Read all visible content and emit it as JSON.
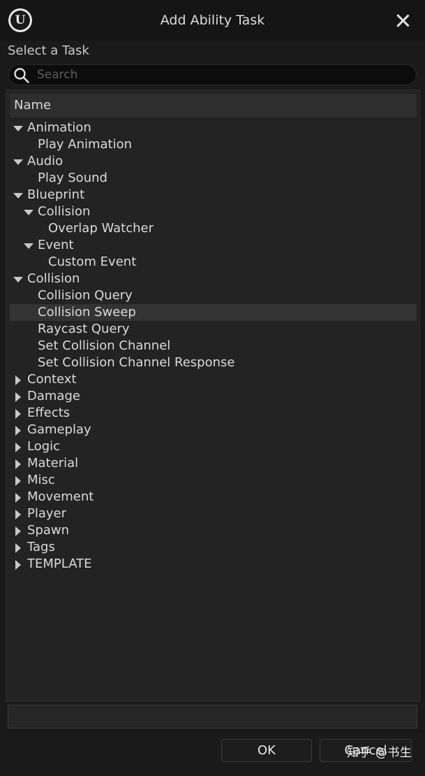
{
  "window": {
    "title": "Add Ability Task",
    "logo_icon": "unreal-engine-logo",
    "logo_glyph": "U"
  },
  "section_label": "Select a Task",
  "search": {
    "placeholder": "Search",
    "value": ""
  },
  "tree": {
    "column_header": "Name",
    "items": [
      {
        "label": "Animation",
        "depth": 0,
        "state": "expanded"
      },
      {
        "label": "Play Animation",
        "depth": 1,
        "state": "leaf"
      },
      {
        "label": "Audio",
        "depth": 0,
        "state": "expanded"
      },
      {
        "label": "Play Sound",
        "depth": 1,
        "state": "leaf"
      },
      {
        "label": "Blueprint",
        "depth": 0,
        "state": "expanded"
      },
      {
        "label": "Collision",
        "depth": 1,
        "state": "expanded"
      },
      {
        "label": "Overlap Watcher",
        "depth": 2,
        "state": "leaf"
      },
      {
        "label": "Event",
        "depth": 1,
        "state": "expanded"
      },
      {
        "label": "Custom Event",
        "depth": 2,
        "state": "leaf"
      },
      {
        "label": "Collision",
        "depth": 0,
        "state": "expanded"
      },
      {
        "label": "Collision Query",
        "depth": 1,
        "state": "leaf"
      },
      {
        "label": "Collision Sweep",
        "depth": 1,
        "state": "leaf",
        "selected": true
      },
      {
        "label": "Raycast Query",
        "depth": 1,
        "state": "leaf"
      },
      {
        "label": "Set Collision Channel",
        "depth": 1,
        "state": "leaf"
      },
      {
        "label": "Set Collision Channel Response",
        "depth": 1,
        "state": "leaf"
      },
      {
        "label": "Context",
        "depth": 0,
        "state": "collapsed"
      },
      {
        "label": "Damage",
        "depth": 0,
        "state": "collapsed"
      },
      {
        "label": "Effects",
        "depth": 0,
        "state": "collapsed"
      },
      {
        "label": "Gameplay",
        "depth": 0,
        "state": "collapsed"
      },
      {
        "label": "Logic",
        "depth": 0,
        "state": "collapsed"
      },
      {
        "label": "Material",
        "depth": 0,
        "state": "collapsed"
      },
      {
        "label": "Misc",
        "depth": 0,
        "state": "collapsed"
      },
      {
        "label": "Movement",
        "depth": 0,
        "state": "collapsed"
      },
      {
        "label": "Player",
        "depth": 0,
        "state": "collapsed"
      },
      {
        "label": "Spawn",
        "depth": 0,
        "state": "collapsed"
      },
      {
        "label": "Tags",
        "depth": 0,
        "state": "collapsed"
      },
      {
        "label": "TEMPLATE",
        "depth": 0,
        "state": "collapsed"
      }
    ]
  },
  "description": "",
  "buttons": {
    "ok": "OK",
    "cancel": "Cancel"
  },
  "watermark": "知乎 @书生",
  "colors": {
    "background": "#1a1a1a",
    "titlebar": "#151515",
    "tree_panel": "#232323",
    "selected_row": "#343434",
    "text": "#dadada"
  }
}
